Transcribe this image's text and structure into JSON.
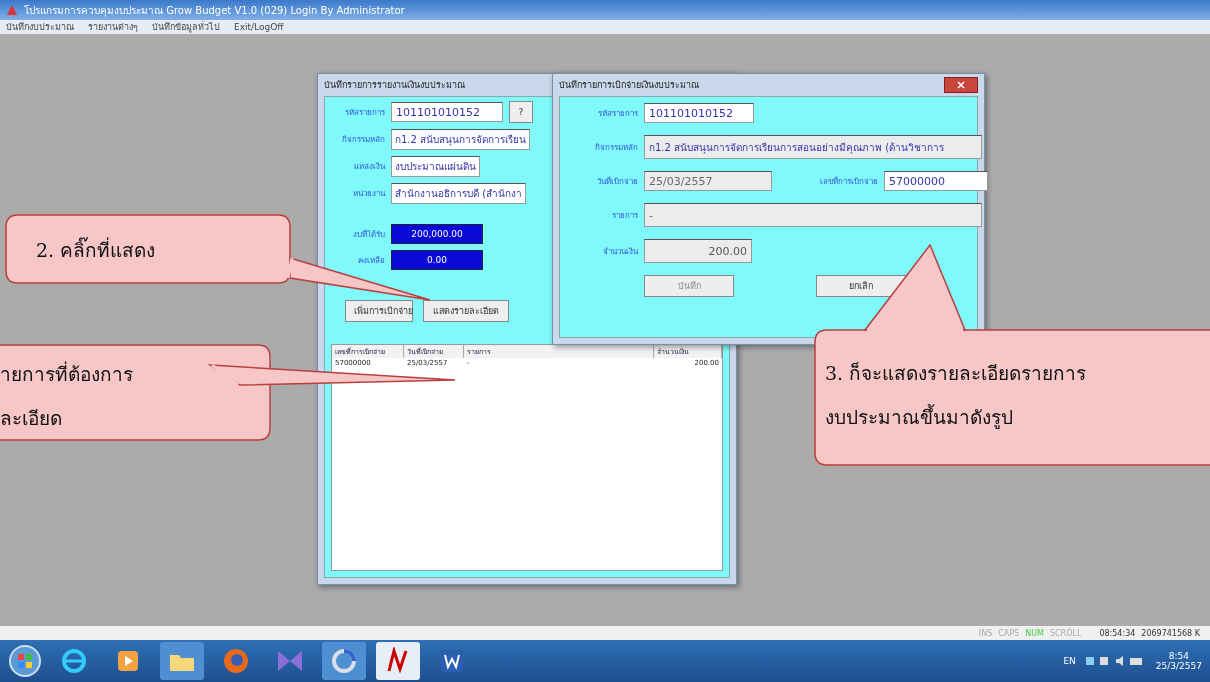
{
  "window": {
    "title": "โปรแกรมการควบคุมงบประมาณ Grow Budget V1.0 (029) Login By Administrator"
  },
  "menu": [
    "บันทึกงบประมาณ",
    "รายงานต่างๆ",
    "บันทึกข้อมูลทั่วไป",
    "Exit/LogOff"
  ],
  "budget_dialog": {
    "title": "บันทึกรายการรายงานเงินงบประมาณ",
    "fields": [
      {
        "label": "รหัสรายการ",
        "value": "101101010152",
        "kind": "lookup"
      },
      {
        "label": "กิจกรรมหลัก",
        "value": "ก1.2 สนับสนุนการจัดการเรียน",
        "kind": "text"
      },
      {
        "label": "แหล่งเงิน",
        "value": "งบประมาณแผ่นดิน",
        "kind": "text"
      },
      {
        "label": "หน่วยงาน",
        "value": "สำนักงานอธิการบดี (สำนักงา",
        "kind": "text"
      }
    ],
    "lookup_button": "?",
    "totals": [
      {
        "label": "งบที่ได้รับ",
        "value": "200,000.00"
      },
      {
        "label": "คงเหลือ",
        "value": "0.00"
      }
    ],
    "buttons": [
      "เพิ่มการเบิกจ่าย",
      "แสดงรายละเอียด"
    ],
    "table": {
      "columns": [
        "เลขที่การเบิกจ่าย",
        "วันที่เบิกจ่าย",
        "รายการ",
        "จำนวนเงิน"
      ],
      "rows": [
        [
          "57000000",
          "25/03/2557",
          "-",
          "200.00"
        ]
      ]
    }
  },
  "detail_dialog": {
    "title": "บันทึกรายการเบิกจ่ายเงินงบประมาณ",
    "code": {
      "label": "รหัสรายการ",
      "value": "101101010152"
    },
    "activity": {
      "label": "กิจกรรมหลัก",
      "value": "ก1.2 สนับสนุนการจัดการเรียนการสอนอย่างมีคุณภาพ (ด้านวิชาการ"
    },
    "date": {
      "label": "วันที่เบิกจ่าย",
      "value": "25/03/2557"
    },
    "number": {
      "label": "เลขที่การเบิกจ่าย",
      "value": "57000000"
    },
    "item": {
      "label": "รายการ",
      "value": "-"
    },
    "amount": {
      "label": "จำนวนเงิน",
      "value": "200.00"
    },
    "buttons": [
      {
        "label": "บันทึก",
        "disabled": true
      },
      {
        "label": "ยกเลิก",
        "disabled": false
      }
    ]
  },
  "callouts": [
    {
      "lines": [
        "2. คลิ๊กที่แสดง"
      ]
    },
    {
      "lines": [
        "ายการที่ต้องการ",
        "ละเอียด"
      ]
    },
    {
      "lines": [
        "3. ก็จะแสดงรายละเอียดรายการ",
        "งบประมาณขึ้นมาดังรูป"
      ]
    }
  ],
  "status_bar": {
    "indicators": [
      {
        "label": "INS",
        "on": false
      },
      {
        "label": "CAPS",
        "on": false
      },
      {
        "label": "NUM",
        "on": true
      },
      {
        "label": "SCROLL",
        "on": false
      }
    ],
    "time": "08:54:34",
    "memory": "2069741568 K"
  },
  "taskbar": {
    "language": "EN",
    "clock": "8:54",
    "date": "25/3/2557"
  }
}
